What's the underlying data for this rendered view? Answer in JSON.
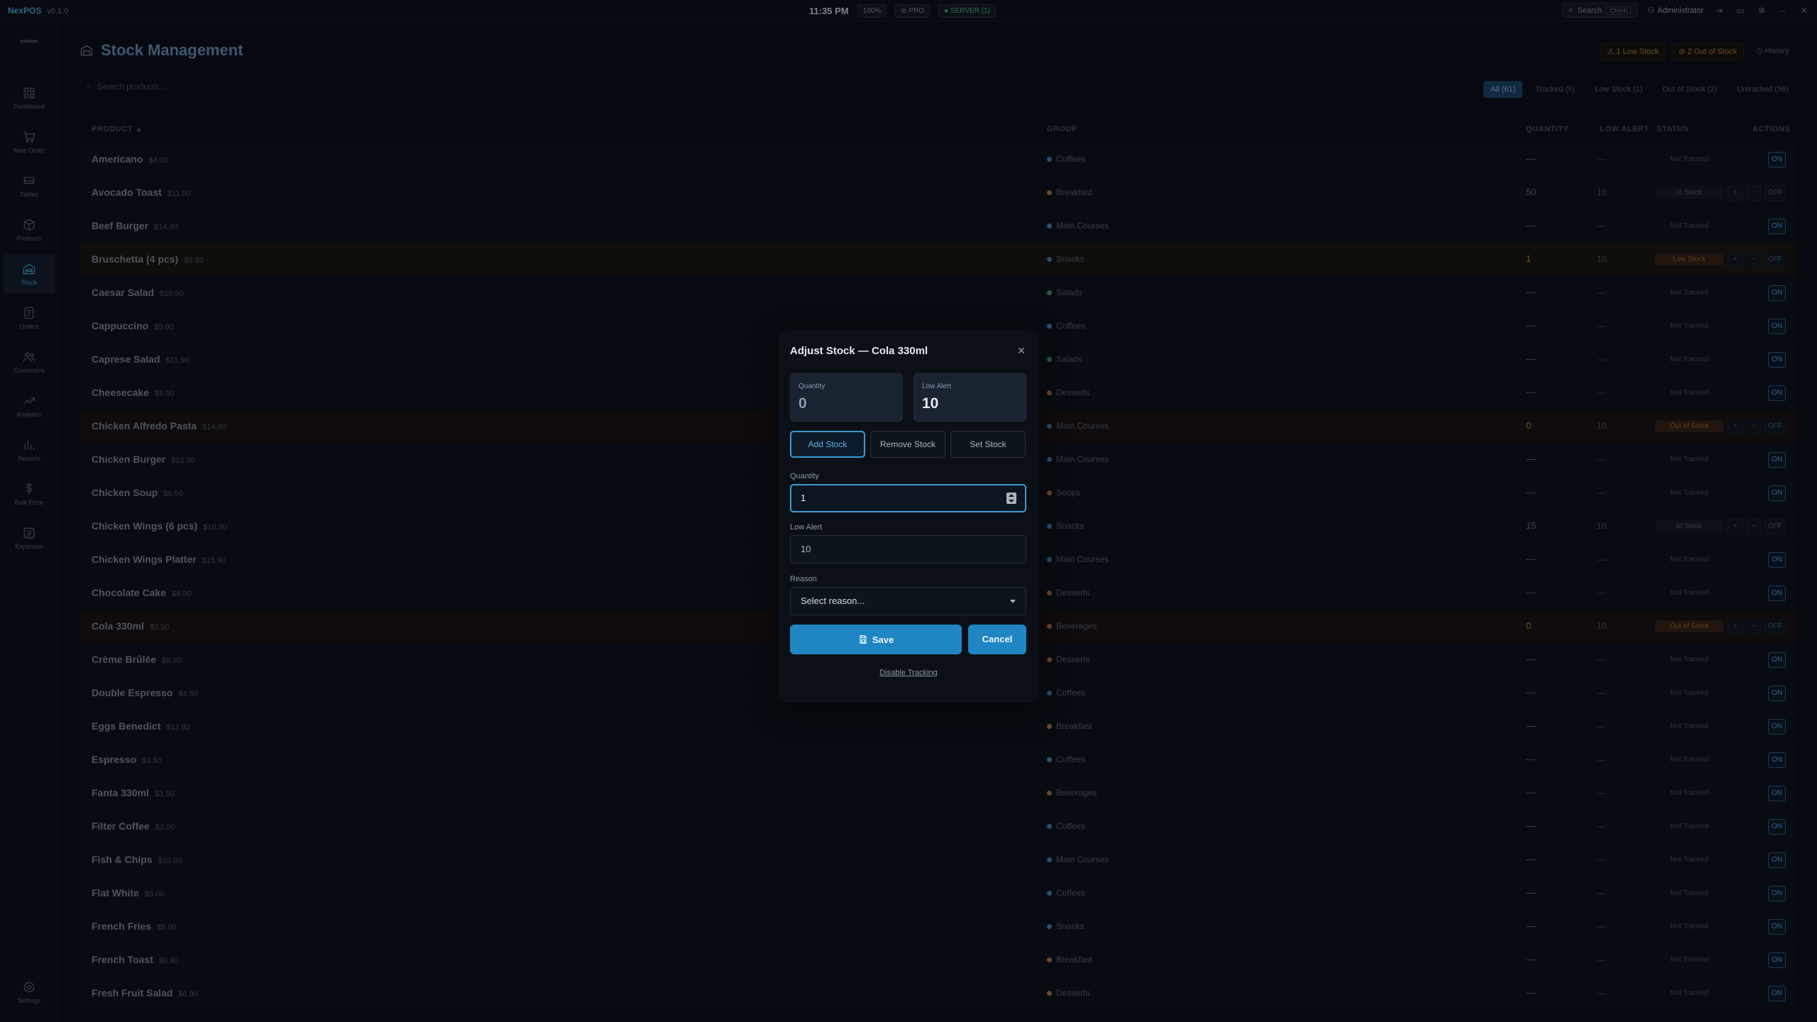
{
  "app": {
    "name": "NexPOS",
    "version": "v0.1.0",
    "time": "11:35 PM",
    "zoom": "100%",
    "plan": "PRO",
    "server": "SERVER (1)",
    "search_label": "Search",
    "search_shortcut": "Ctrl+K",
    "user": "Administrator"
  },
  "sidebar": [
    {
      "id": "dashboard",
      "label": "Dashboard"
    },
    {
      "id": "new-order",
      "label": "New Order"
    },
    {
      "id": "tables",
      "label": "Tables"
    },
    {
      "id": "products",
      "label": "Products"
    },
    {
      "id": "stock",
      "label": "Stock",
      "active": true
    },
    {
      "id": "orders",
      "label": "Orders"
    },
    {
      "id": "customers",
      "label": "Customers"
    },
    {
      "id": "analytics",
      "label": "Analytics"
    },
    {
      "id": "reports",
      "label": "Reports"
    },
    {
      "id": "bulk-price",
      "label": "Bulk Price"
    },
    {
      "id": "expenses",
      "label": "Expenses"
    }
  ],
  "settings_label": "Settings",
  "page": {
    "title": "Stock Management",
    "low_badge": "1 Low Stock",
    "out_badge": "2 Out of Stock",
    "history": "History",
    "search_placeholder": "Search products...",
    "filters": [
      {
        "label": "All (61)",
        "active": true
      },
      {
        "label": "Tracked (5)"
      },
      {
        "label": "Low Stock (1)"
      },
      {
        "label": "Out of Stock (2)"
      },
      {
        "label": "Untracked (56)"
      }
    ],
    "columns": {
      "product": "PRODUCT ▲",
      "group": "GROUP",
      "quantity": "QUANTITY",
      "low_alert": "LOW ALERT",
      "status": "STATUS",
      "actions": "ACTIONS"
    }
  },
  "group_colors": {
    "Coffees": "#3f8fc4",
    "Breakfast": "#c57b34",
    "Main Courses": "#3f8fc4",
    "Snacks": "#3f8fc4",
    "Salads": "#4aa56a",
    "Desserts": "#c57b34",
    "Soups": "#c57b34",
    "Beverages": "#c57b34"
  },
  "rows": [
    {
      "name": "Americano",
      "price": "$4.00",
      "group": "Coffees",
      "qty": "—",
      "low": "—",
      "status": "Not Tracked"
    },
    {
      "name": "Avocado Toast",
      "price": "$11.90",
      "group": "Breakfast",
      "qty": "50",
      "low": "10",
      "status": "In Stock",
      "tracked": true
    },
    {
      "name": "Beef Burger",
      "price": "$14.90",
      "group": "Main Courses",
      "qty": "—",
      "low": "—",
      "status": "Not Tracked"
    },
    {
      "name": "Bruschetta (4 pcs)",
      "price": "$8.90",
      "group": "Snacks",
      "qty": "1",
      "low": "10",
      "status": "Low Stock",
      "tracked": true,
      "state": "low"
    },
    {
      "name": "Caesar Salad",
      "price": "$10.90",
      "group": "Salads",
      "qty": "—",
      "low": "—",
      "status": "Not Tracked"
    },
    {
      "name": "Cappuccino",
      "price": "$5.00",
      "group": "Coffees",
      "qty": "—",
      "low": "—",
      "status": "Not Tracked"
    },
    {
      "name": "Caprese Salad",
      "price": "$11.90",
      "group": "Salads",
      "qty": "—",
      "low": "—",
      "status": "Not Tracked"
    },
    {
      "name": "Cheesecake",
      "price": "$9.90",
      "group": "Desserts",
      "qty": "—",
      "low": "—",
      "status": "Not Tracked"
    },
    {
      "name": "Chicken Alfredo Pasta",
      "price": "$14.90",
      "group": "Main Courses",
      "qty": "0",
      "low": "10",
      "status": "Out of Stock",
      "tracked": true,
      "state": "out"
    },
    {
      "name": "Chicken Burger",
      "price": "$12.90",
      "group": "Main Courses",
      "qty": "—",
      "low": "—",
      "status": "Not Tracked"
    },
    {
      "name": "Chicken Soup",
      "price": "$6.50",
      "group": "Soups",
      "qty": "—",
      "low": "—",
      "status": "Not Tracked"
    },
    {
      "name": "Chicken Wings (6 pcs)",
      "price": "$10.90",
      "group": "Snacks",
      "qty": "15",
      "low": "10",
      "status": "In Stock",
      "tracked": true
    },
    {
      "name": "Chicken Wings Platter",
      "price": "$15.90",
      "group": "Main Courses",
      "qty": "—",
      "low": "—",
      "status": "Not Tracked"
    },
    {
      "name": "Chocolate Cake",
      "price": "$8.90",
      "group": "Desserts",
      "qty": "—",
      "low": "—",
      "status": "Not Tracked"
    },
    {
      "name": "Cola 330ml",
      "price": "$3.50",
      "group": "Beverages",
      "qty": "0",
      "low": "10",
      "status": "Out of Stock",
      "tracked": true,
      "state": "out"
    },
    {
      "name": "Crème Brûlée",
      "price": "$9.90",
      "group": "Desserts",
      "qty": "—",
      "low": "—",
      "status": "Not Tracked"
    },
    {
      "name": "Double Espresso",
      "price": "$4.50",
      "group": "Coffees",
      "qty": "—",
      "low": "—",
      "status": "Not Tracked"
    },
    {
      "name": "Eggs Benedict",
      "price": "$12.90",
      "group": "Breakfast",
      "qty": "—",
      "low": "—",
      "status": "Not Tracked"
    },
    {
      "name": "Espresso",
      "price": "$3.50",
      "group": "Coffees",
      "qty": "—",
      "low": "—",
      "status": "Not Tracked"
    },
    {
      "name": "Fanta 330ml",
      "price": "$3.50",
      "group": "Beverages",
      "qty": "—",
      "low": "—",
      "status": "Not Tracked"
    },
    {
      "name": "Filter Coffee",
      "price": "$3.00",
      "group": "Coffees",
      "qty": "—",
      "low": "—",
      "status": "Not Tracked"
    },
    {
      "name": "Fish & Chips",
      "price": "$15.90",
      "group": "Main Courses",
      "qty": "—",
      "low": "—",
      "status": "Not Tracked"
    },
    {
      "name": "Flat White",
      "price": "$5.00",
      "group": "Coffees",
      "qty": "—",
      "low": "—",
      "status": "Not Tracked"
    },
    {
      "name": "French Fries",
      "price": "$5.90",
      "group": "Snacks",
      "qty": "—",
      "low": "—",
      "status": "Not Tracked"
    },
    {
      "name": "French Toast",
      "price": "$9.90",
      "group": "Breakfast",
      "qty": "—",
      "low": "—",
      "status": "Not Tracked"
    },
    {
      "name": "Fresh Fruit Salad",
      "price": "$6.90",
      "group": "Desserts",
      "qty": "—",
      "low": "—",
      "status": "Not Tracked"
    }
  ],
  "row_actions": {
    "plus": "+",
    "minus": "−",
    "off": "OFF",
    "on": "ON"
  },
  "modal": {
    "title": "Adjust Stock — Cola 330ml",
    "quantity_label": "Quantity",
    "quantity_value": "0",
    "alert_label": "Low Alert",
    "alert_value": "10",
    "tabs": [
      "Add Stock",
      "Remove Stock",
      "Set Stock"
    ],
    "field_quantity_label": "Quantity",
    "field_quantity_value": "1",
    "field_alert_label": "Low Alert",
    "field_alert_value": "10",
    "reason_label": "Reason",
    "reason_value": "Select reason...",
    "save": "Save",
    "cancel": "Cancel",
    "disable": "Disable Tracking"
  }
}
